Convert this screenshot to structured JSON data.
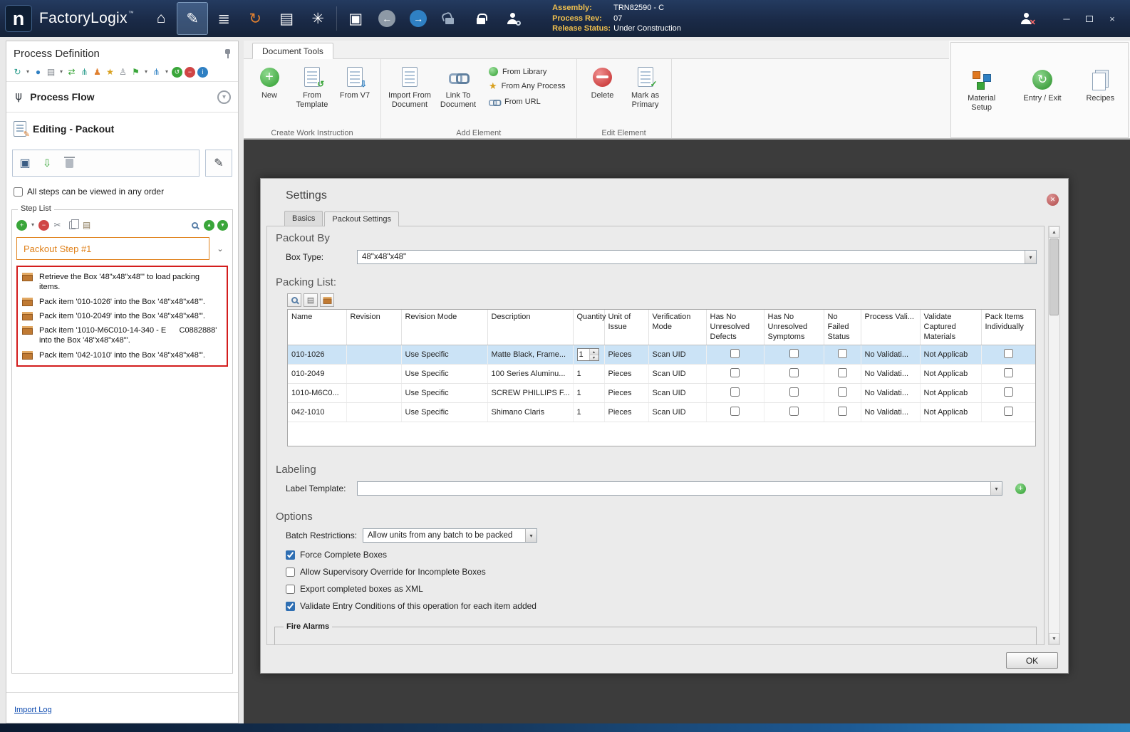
{
  "icons": {
    "house": "⌂",
    "pencil": "✎",
    "stack": "≣",
    "refresh": "↻",
    "rows": "▤",
    "gear": "✳",
    "floppy": "▣",
    "arrow_left": "←",
    "arrow_right": "→",
    "dash": "─",
    "times": "×",
    "caret_down": "▾",
    "chevron_down": "⌄",
    "dot": "●",
    "swap": "⇄",
    "hierarchy": "⋔",
    "pawn": "♟",
    "pawn_light": "♙",
    "star": "★",
    "flag": "⚑",
    "undo": "↺",
    "minus": "−",
    "info": "i",
    "import_down": "⇩",
    "plus": "+",
    "scissors": "✂",
    "up_triangle": "▲",
    "down_triangle": "▼",
    "check": "✓",
    "cross": "✕"
  },
  "titlebar": {
    "logo_letter": "n",
    "app_name": "FactoryLogix",
    "trademark": "™",
    "assembly_label": "Assembly:",
    "assembly_value": "TRN82590 - C",
    "process_rev_label": "Process Rev:",
    "process_rev_value": "07",
    "release_status_label": "Release Status:",
    "release_status_value": "Under Construction"
  },
  "sidebar": {
    "title": "Process Definition",
    "process_flow": "Process Flow",
    "editing": "Editing - Packout",
    "order_checkbox": "All steps can be viewed in any order",
    "order_checked": false,
    "step_list_title": "Step List",
    "step_name": "Packout Step #1",
    "steps": [
      "Retrieve the Box '48\"x48\"x48\"' to load packing items.",
      "Pack item '010-1026' into the Box '48\"x48\"x48\"'.",
      "Pack item '010-2049' into the Box '48\"x48\"x48\"'.",
      "Pack item '1010-M6C010-14-340 - E      C0882888' into the Box '48\"x48\"x48\"'.",
      "Pack item '042-1010' into the Box '48\"x48\"x48\"'."
    ],
    "import_log": "Import Log"
  },
  "ribbon": {
    "tab": "Document Tools",
    "create_group": {
      "label": "Create Work Instruction",
      "new": "New",
      "from_template": "From Template",
      "from_v7": "From V7"
    },
    "add_group": {
      "label": "Add Element",
      "import_from_document": "Import From Document",
      "link_to_document": "Link To Document",
      "from_library": "From Library",
      "from_any_process": "From Any Process",
      "from_url": "From URL"
    },
    "edit_group": {
      "label": "Edit Element",
      "delete": "Delete",
      "mark_as_primary": "Mark as Primary"
    },
    "right_panel": {
      "material_setup": "Material Setup",
      "entry_exit": "Entry / Exit",
      "recipes": "Recipes"
    }
  },
  "dialog": {
    "title": "Settings",
    "tabs": [
      "Basics",
      "Packout Settings"
    ],
    "active_tab": "Packout Settings",
    "packout_by": {
      "heading": "Packout By",
      "box_type_label": "Box Type:",
      "box_type_value": "48\"x48\"x48\""
    },
    "packing_list": {
      "heading": "Packing List:",
      "columns": [
        "Name",
        "Revision",
        "Revision Mode",
        "Description",
        "Quantity",
        "Unit of Issue",
        "Verification Mode",
        "Has No Unresolved Defects",
        "Has No Unresolved Symptoms",
        "No Failed Status",
        "Process Vali...",
        "Validate Captured Materials",
        "Pack Items Individually"
      ],
      "rows": [
        {
          "name": "010-1026",
          "revision": "",
          "revision_mode": "Use Specific",
          "description": "Matte Black, Frame...",
          "quantity": "1",
          "unit_of_issue": "Pieces",
          "verification_mode": "Scan UID",
          "has_no_unresolved_defects": false,
          "has_no_unresolved_symptoms": false,
          "no_failed_status": false,
          "process_validation": "No Validati...",
          "validate_captured_materials": "Not Applicab",
          "pack_items_individually": false,
          "selected": true,
          "quantity_editing": true
        },
        {
          "name": "010-2049",
          "revision": "",
          "revision_mode": "Use Specific",
          "description": "100 Series Aluminu...",
          "quantity": "1",
          "unit_of_issue": "Pieces",
          "verification_mode": "Scan UID",
          "has_no_unresolved_defects": false,
          "has_no_unresolved_symptoms": false,
          "no_failed_status": false,
          "process_validation": "No Validati...",
          "validate_captured_materials": "Not Applicab",
          "pack_items_individually": false,
          "selected": false,
          "quantity_editing": false
        },
        {
          "name": "1010-M6C0...",
          "revision": "",
          "revision_mode": "Use Specific",
          "description": "SCREW PHILLIPS F...",
          "quantity": "1",
          "unit_of_issue": "Pieces",
          "verification_mode": "Scan UID",
          "has_no_unresolved_defects": false,
          "has_no_unresolved_symptoms": false,
          "no_failed_status": false,
          "process_validation": "No Validati...",
          "validate_captured_materials": "Not Applicab",
          "pack_items_individually": false,
          "selected": false,
          "quantity_editing": false
        },
        {
          "name": "042-1010",
          "revision": "",
          "revision_mode": "Use Specific",
          "description": "Shimano Claris",
          "quantity": "1",
          "unit_of_issue": "Pieces",
          "verification_mode": "Scan UID",
          "has_no_unresolved_defects": false,
          "has_no_unresolved_symptoms": false,
          "no_failed_status": false,
          "process_validation": "No Validati...",
          "validate_captured_materials": "Not Applicab",
          "pack_items_individually": false,
          "selected": false,
          "quantity_editing": false
        }
      ]
    },
    "labeling": {
      "heading": "Labeling",
      "label_template_label": "Label Template:",
      "label_template_value": ""
    },
    "options": {
      "heading": "Options",
      "batch_restrictions_label": "Batch Restrictions:",
      "batch_restrictions_value": "Allow units from any batch to be packed",
      "checkboxes": [
        {
          "label": "Force Complete Boxes",
          "checked": true
        },
        {
          "label": "Allow Supervisory Override for Incomplete Boxes",
          "checked": false
        },
        {
          "label": "Export completed boxes as XML",
          "checked": false
        },
        {
          "label": "Validate Entry Conditions of this operation for each item added",
          "checked": true
        }
      ]
    },
    "fire_alarms_label": "Fire Alarms",
    "ok_label": "OK"
  }
}
